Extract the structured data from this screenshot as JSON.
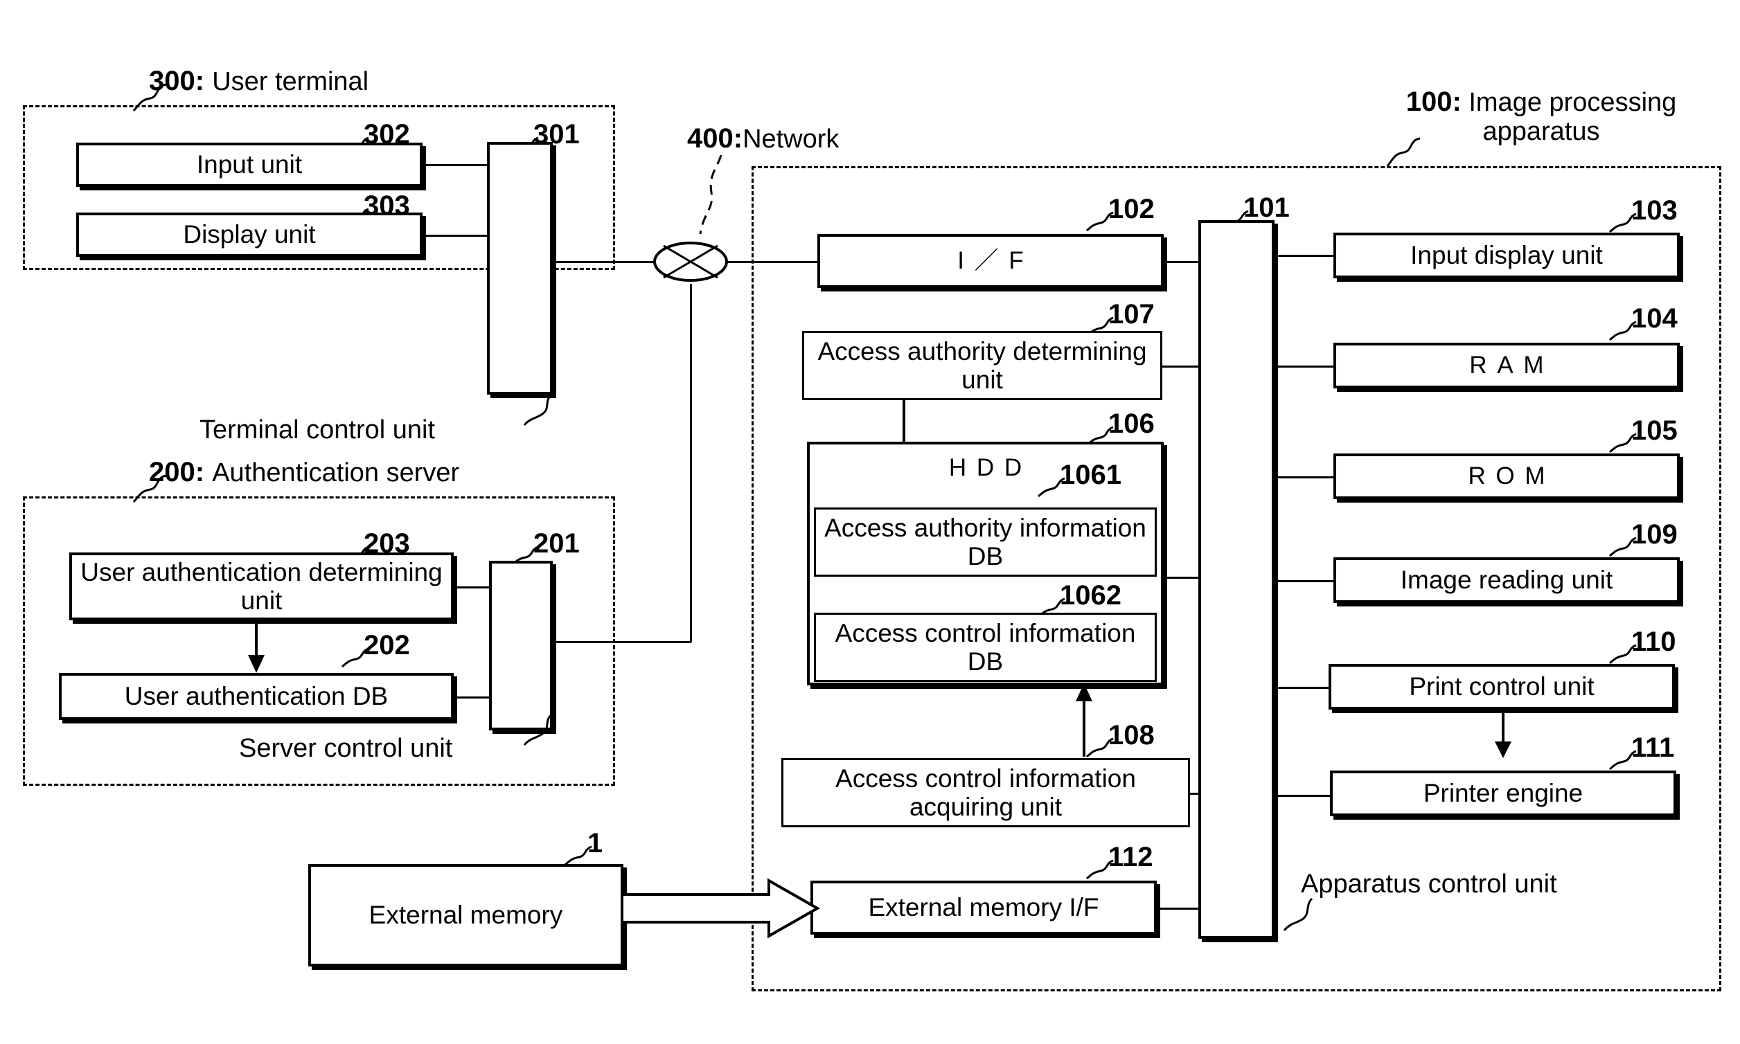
{
  "figure": {
    "type": "patent-block-diagram",
    "title": "Image processing apparatus / user terminal / authentication server block diagram"
  },
  "groups": {
    "user_terminal": {
      "ref": "300:",
      "label": "User terminal",
      "caption": "Terminal control unit"
    },
    "auth_server": {
      "ref": "200:",
      "label": "Authentication server",
      "caption": "Server control unit"
    },
    "network": {
      "ref": "400:",
      "label": "Network",
      "node_icon": "network-cloud-node-icon"
    },
    "image_processing_apparatus": {
      "ref": "100:",
      "label_line1": "Image processing",
      "label_line2": "apparatus",
      "caption": "Apparatus control unit"
    }
  },
  "blocks": {
    "input_unit": {
      "ref": "302",
      "label": "Input unit"
    },
    "display_unit": {
      "ref": "303",
      "label": "Display unit"
    },
    "terminal_control_unit": {
      "ref": "301",
      "label": ""
    },
    "user_auth_determining": {
      "ref": "203",
      "label": "User authentication determining unit"
    },
    "user_auth_db": {
      "ref": "202",
      "label": "User authentication DB"
    },
    "server_control_unit": {
      "ref": "201",
      "label": ""
    },
    "external_memory": {
      "ref": "1",
      "label": "External memory"
    },
    "interface": {
      "ref": "102",
      "label": "I／F"
    },
    "access_authority_determining": {
      "ref": "107",
      "label": "Access authority determining unit"
    },
    "hdd": {
      "ref": "106",
      "label": "HDD"
    },
    "access_authority_info_db": {
      "ref": "1061",
      "label": "Access authority information DB"
    },
    "access_control_info_db": {
      "ref": "1062",
      "label": "Access control information DB"
    },
    "access_control_info_acquiring": {
      "ref": "108",
      "label": "Access control information acquiring unit"
    },
    "external_memory_if": {
      "ref": "112",
      "label": "External memory I/F"
    },
    "apparatus_control_unit": {
      "ref": "101",
      "label": ""
    },
    "input_display_unit": {
      "ref": "103",
      "label": "Input display unit"
    },
    "ram": {
      "ref": "104",
      "label": "RAM"
    },
    "rom": {
      "ref": "105",
      "label": "ROM"
    },
    "image_reading_unit": {
      "ref": "109",
      "label": "Image reading unit"
    },
    "print_control_unit": {
      "ref": "110",
      "label": "Print control unit"
    },
    "printer_engine": {
      "ref": "111",
      "label": "Printer engine"
    }
  },
  "colors": {
    "ink": "#000000",
    "paper": "#ffffff"
  }
}
